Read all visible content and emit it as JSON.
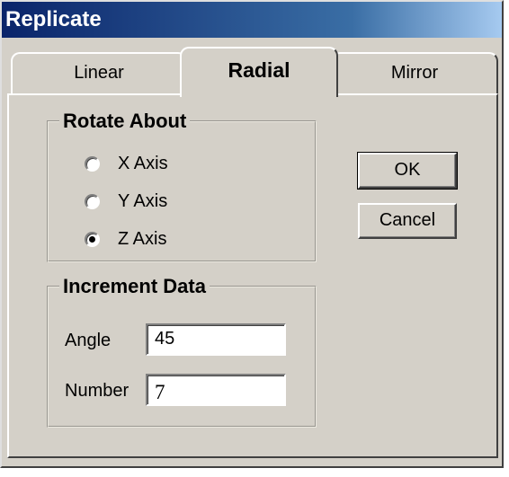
{
  "window": {
    "title": "Replicate"
  },
  "tabs": [
    {
      "label": "Linear",
      "selected": false
    },
    {
      "label": "Radial",
      "selected": true
    },
    {
      "label": "Mirror",
      "selected": false
    }
  ],
  "rotate_about": {
    "title": "Rotate About",
    "options": [
      {
        "label": "X Axis",
        "checked": false
      },
      {
        "label": "Y Axis",
        "checked": false
      },
      {
        "label": "Z Axis",
        "checked": true
      }
    ]
  },
  "increment_data": {
    "title": "Increment Data",
    "angle": {
      "label": "Angle",
      "value": "45"
    },
    "number": {
      "label": "Number",
      "value": "7"
    }
  },
  "buttons": {
    "ok": "OK",
    "cancel": "Cancel"
  }
}
